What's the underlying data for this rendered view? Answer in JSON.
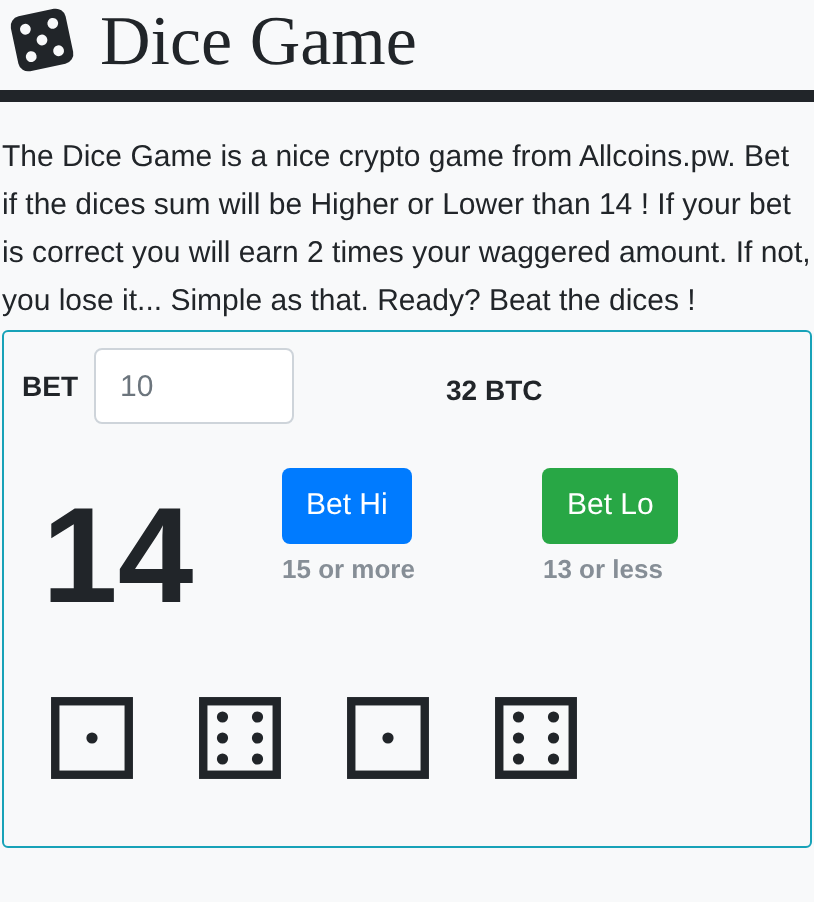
{
  "title": "Dice Game",
  "intro": "The Dice Game is a nice crypto game from Allcoins.pw. Bet if the dices sum will be Higher or Lower than 14 ! If your bet is correct you will earn 2 times your waggered amount. If not, you lose it... Simple as that. Ready? Beat the dices !",
  "bet": {
    "label": "BET",
    "placeholder": "10"
  },
  "balance": "32 BTC",
  "sum": "14",
  "actions": [
    {
      "kind": "hi",
      "label": "Bet Hi",
      "hint": "15 or more"
    },
    {
      "kind": "lo",
      "label": "Bet Lo",
      "hint": "13 or less"
    }
  ],
  "dice": [
    {
      "kind": "one"
    },
    {
      "kind": "six"
    },
    {
      "kind": "one"
    },
    {
      "kind": "six"
    }
  ]
}
